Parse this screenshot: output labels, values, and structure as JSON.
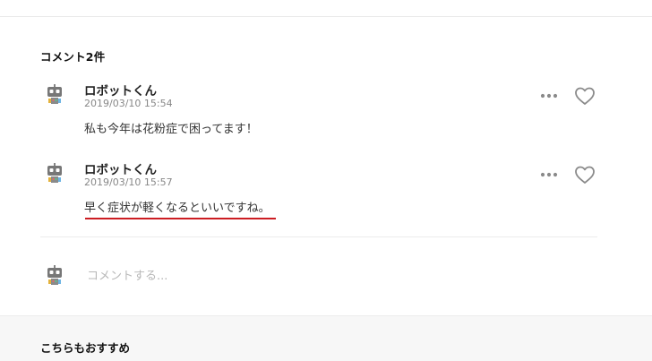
{
  "section": {
    "title": "コメント2件"
  },
  "comments": [
    {
      "author": "ロボットくん",
      "date": "2019/03/10 15:54",
      "text": "私も今年は花粉症で困ってます！",
      "avatar_icon": "robot-avatar-icon",
      "more_icon": "more-dots-icon",
      "like_icon": "heart-outline-icon"
    },
    {
      "author": "ロボットくん",
      "date": "2019/03/10 15:57",
      "text": "早く症状が軽くなるといいですね。",
      "avatar_icon": "robot-avatar-icon",
      "more_icon": "more-dots-icon",
      "like_icon": "heart-outline-icon"
    }
  ],
  "composer": {
    "placeholder": "コメントする...",
    "value": ""
  },
  "recommend": {
    "title": "こちらもおすすめ"
  },
  "colors": {
    "accent_underline": "#cc1d22",
    "muted_text": "#888888",
    "icon_gray": "#8a8a8a"
  }
}
